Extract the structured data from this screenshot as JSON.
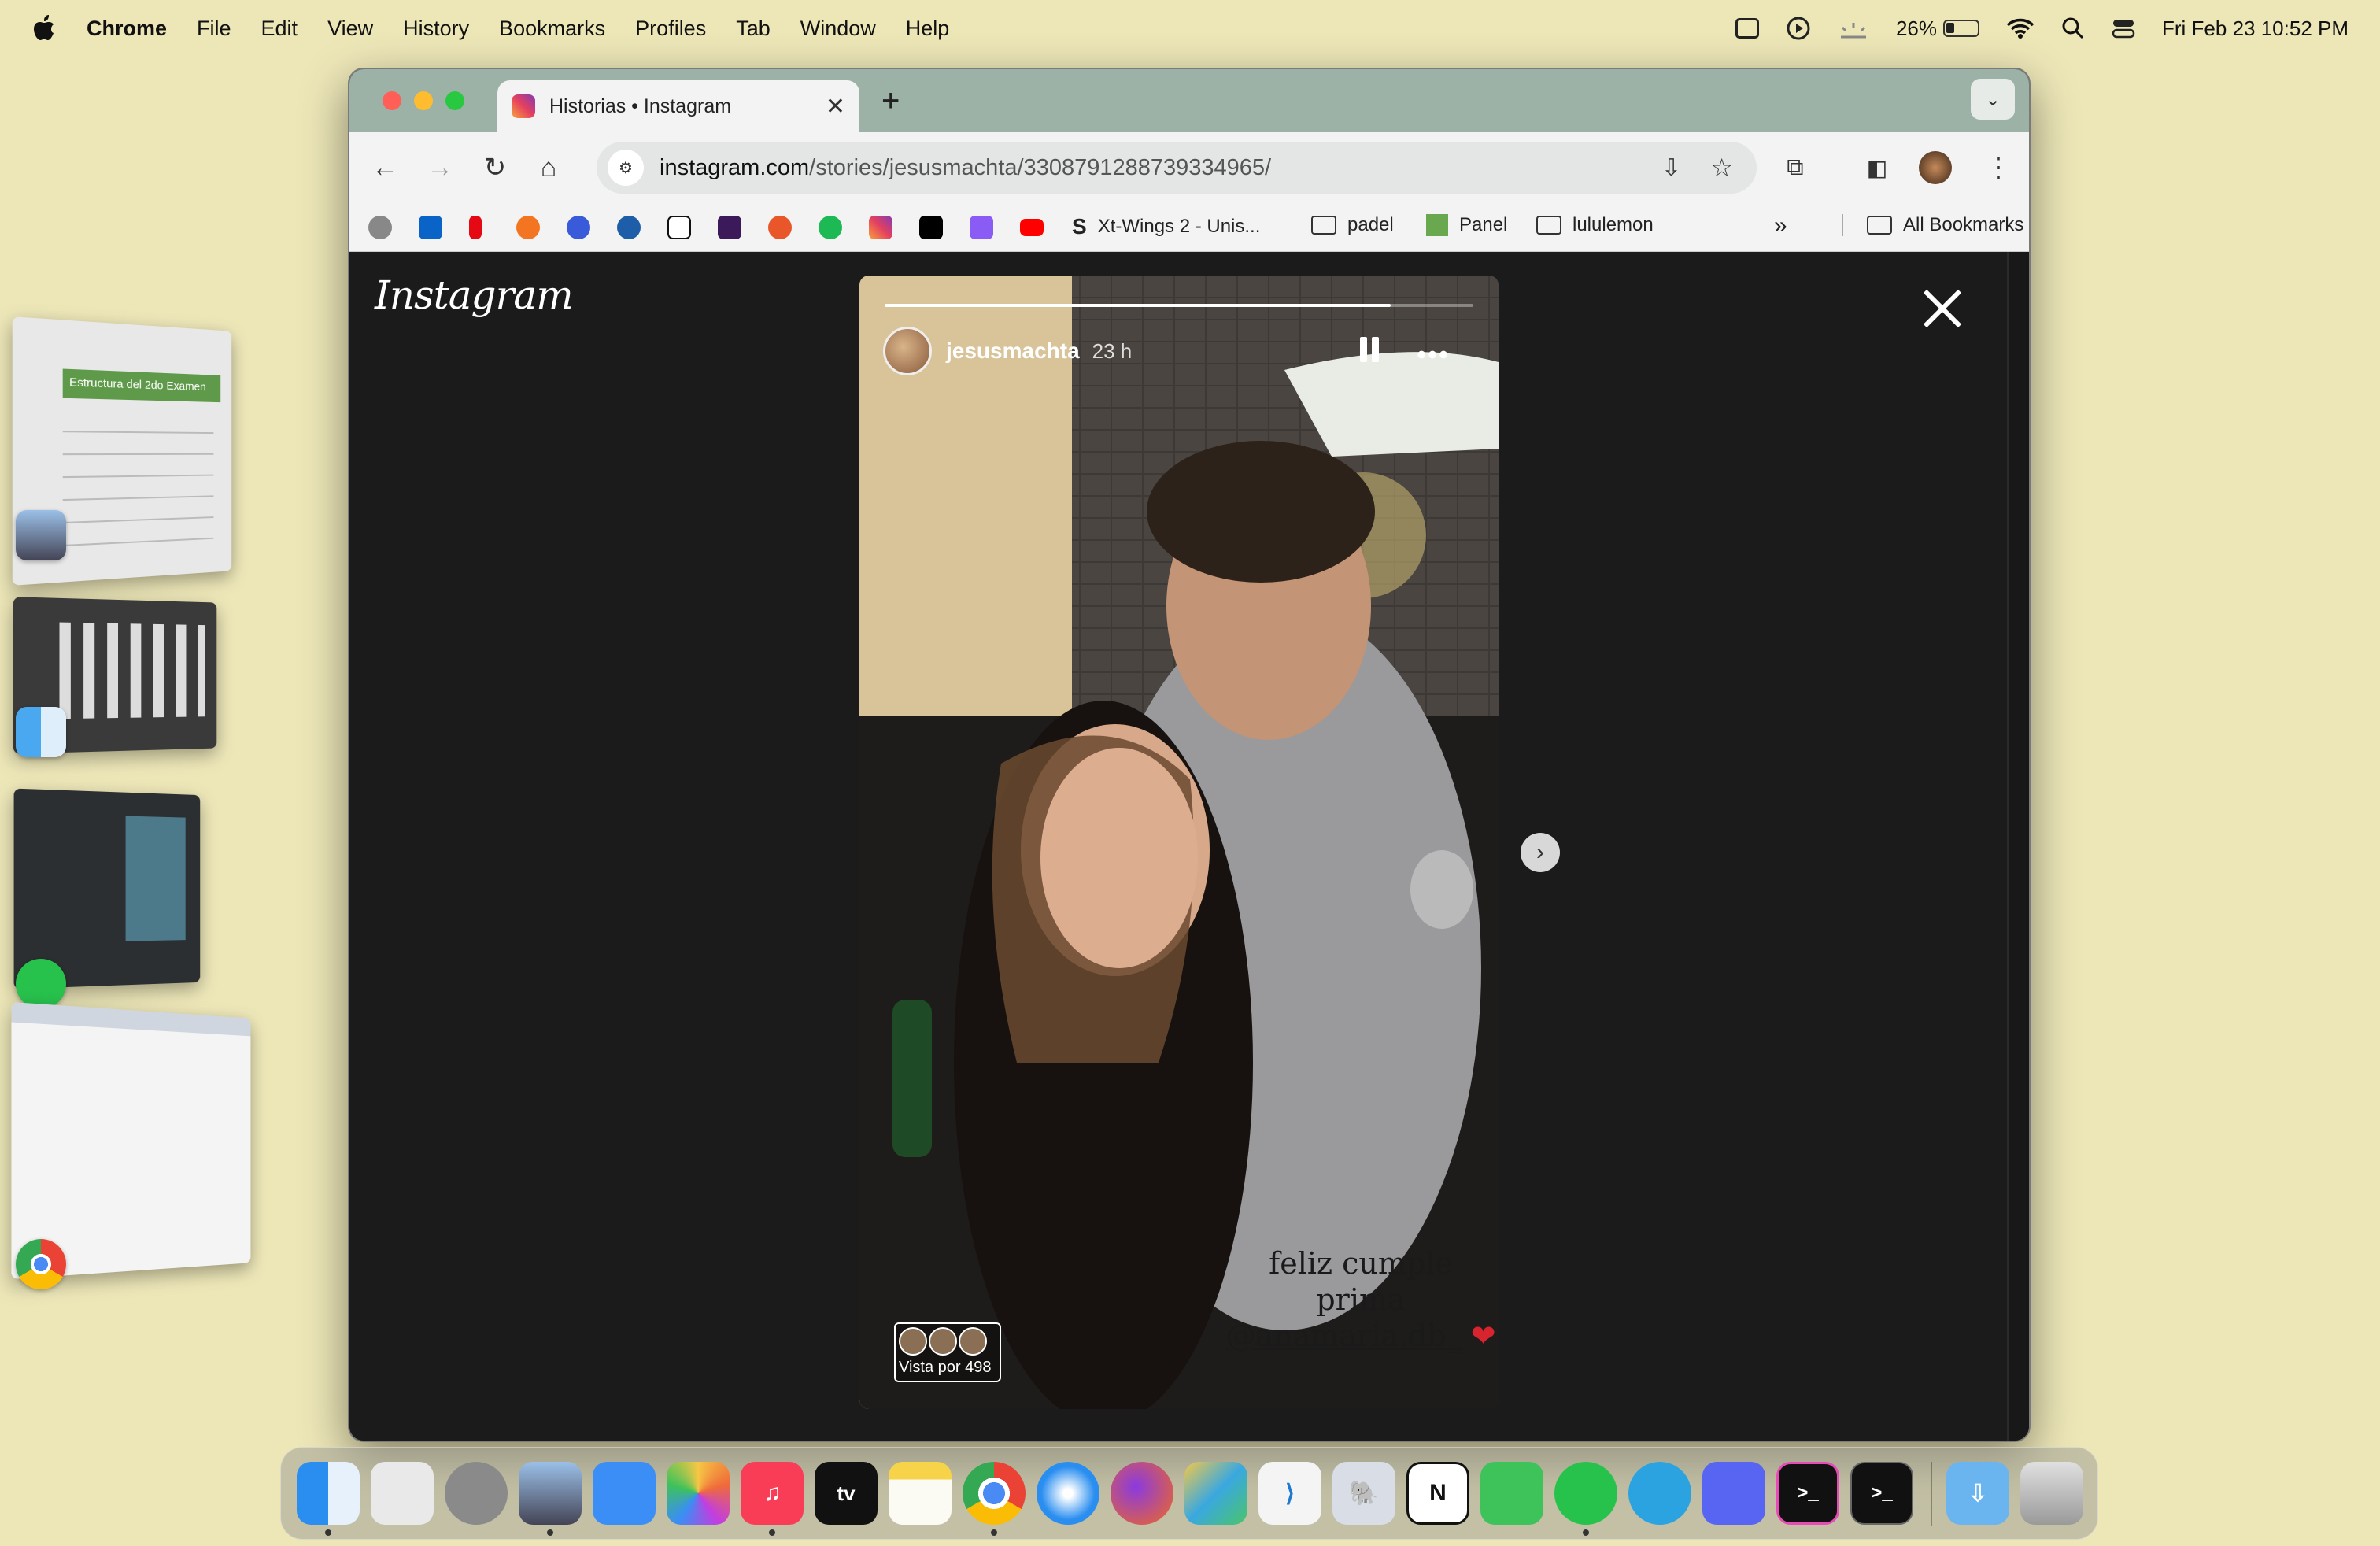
{
  "menubar": {
    "app": "Chrome",
    "items": [
      "File",
      "Edit",
      "View",
      "History",
      "Bookmarks",
      "Profiles",
      "Tab",
      "Window",
      "Help"
    ],
    "battery": "26%",
    "datetime": "Fri Feb 23  10:52 PM"
  },
  "browser": {
    "tab_title": "Historias • Instagram",
    "url_host": "instagram.com",
    "url_path": "/stories/jesusmachta/3308791288739334965/",
    "bookmarks": {
      "xt_wings": "Xt-Wings 2 - Unis...",
      "padel": "padel",
      "panel": "Panel",
      "lululemon": "lululemon",
      "all": "All Bookmarks"
    }
  },
  "instagram": {
    "logo": "Instagram",
    "story": {
      "username": "jesusmachta",
      "time": "23 h",
      "progress": 0.86,
      "caption_line1": "feliz cumple prima",
      "caption_mention": "@anamaria.db_",
      "caption_heart": "❤",
      "viewers": "Vista por 498"
    }
  },
  "stage_manager": {
    "thumb1_title": "Estructura del 2do Examen"
  },
  "colors": {
    "menubar_bg": "#ede7b8",
    "tabbar": "#9db2a7",
    "ig_bg": "#1b1b1b"
  }
}
